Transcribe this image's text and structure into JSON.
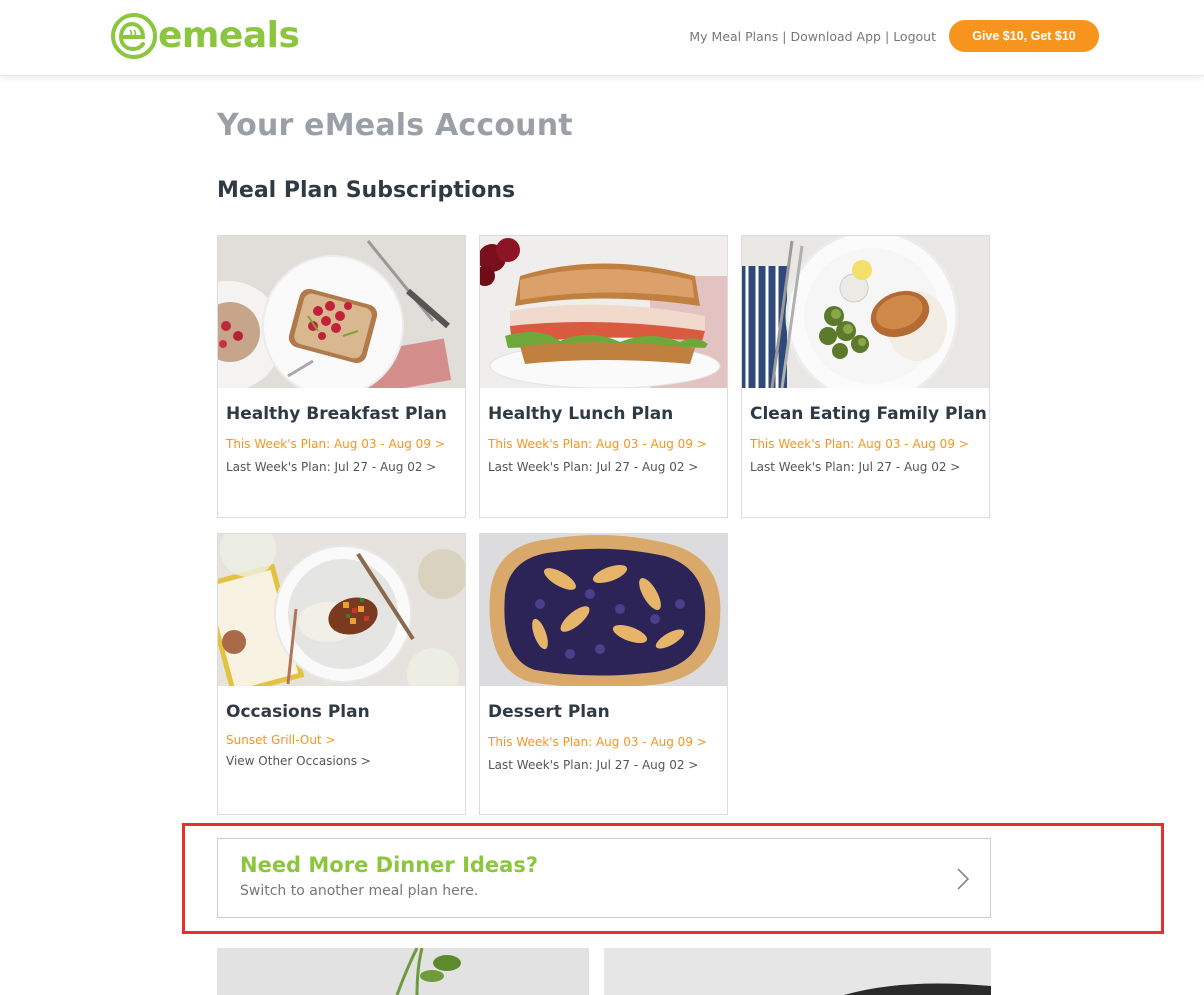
{
  "header": {
    "logo_text": "emeals",
    "nav": [
      {
        "label": "My Meal Plans"
      },
      {
        "label": "Download App"
      },
      {
        "label": "Logout"
      }
    ],
    "separator": "|",
    "referral_button": "Give $10, Get $10"
  },
  "page_title": "Your eMeals Account",
  "section_title": "Meal Plan Subscriptions",
  "plans": [
    {
      "name": "Healthy Breakfast Plan",
      "this_week": "This Week's Plan: Aug 03 - Aug 09 >",
      "last_week": "Last Week's Plan: Jul 27 - Aug 02 >"
    },
    {
      "name": "Healthy Lunch Plan",
      "this_week": "This Week's Plan: Aug 03 - Aug 09 >",
      "last_week": "Last Week's Plan: Jul 27 - Aug 02 >"
    },
    {
      "name": "Clean Eating Family Plan",
      "this_week": "This Week's Plan: Aug 03 - Aug 09 >",
      "last_week": "Last Week's Plan: Jul 27 - Aug 02 >"
    },
    {
      "name": "Occasions Plan",
      "link1": "Sunset Grill-Out >",
      "link2": "View Other Occasions >"
    },
    {
      "name": "Dessert Plan",
      "this_week": "This Week's Plan: Aug 03 - Aug 09 >",
      "last_week": "Last Week's Plan: Jul 27 - Aug 02 >"
    }
  ],
  "banner": {
    "title": "Need More Dinner Ideas?",
    "subtitle": "Switch to another meal plan here."
  },
  "colors": {
    "brand_green": "#8cc63f",
    "accent_orange": "#f7941e",
    "highlight_red": "#e8302a"
  }
}
